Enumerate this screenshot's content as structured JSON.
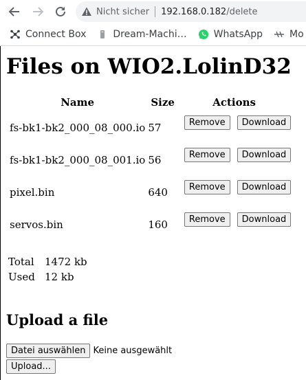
{
  "browser": {
    "security_label": "Nicht sicher",
    "url_host": "192.168.0.182",
    "url_path": "/delete"
  },
  "bookmarks": [
    {
      "label": "Connect Box",
      "icon": "bookmark-hub-icon"
    },
    {
      "label": "Dream-Machi…",
      "icon": "bookmark-dream-icon"
    },
    {
      "label": "WhatsApp",
      "icon": "whatsapp-icon",
      "color": "#25d366"
    },
    {
      "label": "Mo",
      "icon": "bookmark-generic-icon"
    }
  ],
  "page": {
    "title": "Files on WIO2.LolinD32",
    "table_headers": {
      "name": "Name",
      "size": "Size",
      "actions": "Actions"
    },
    "files": [
      {
        "name": "fs-bk1-bk2_000_08_000.io",
        "size": "57"
      },
      {
        "name": "fs-bk1-bk2_000_08_001.io",
        "size": "56"
      },
      {
        "name": "pixel.bin",
        "size": "640"
      },
      {
        "name": "servos.bin",
        "size": "160"
      }
    ],
    "remove_label": "Remove",
    "download_label": "Download",
    "total_label": "Total",
    "total_value": "1472 kb",
    "used_label": "Used",
    "used_value": "12 kb",
    "upload_heading": "Upload a file",
    "choose_file_label": "Datei auswählen",
    "no_file_text": "Keine ausgewählt",
    "upload_button_label": "Upload..."
  }
}
